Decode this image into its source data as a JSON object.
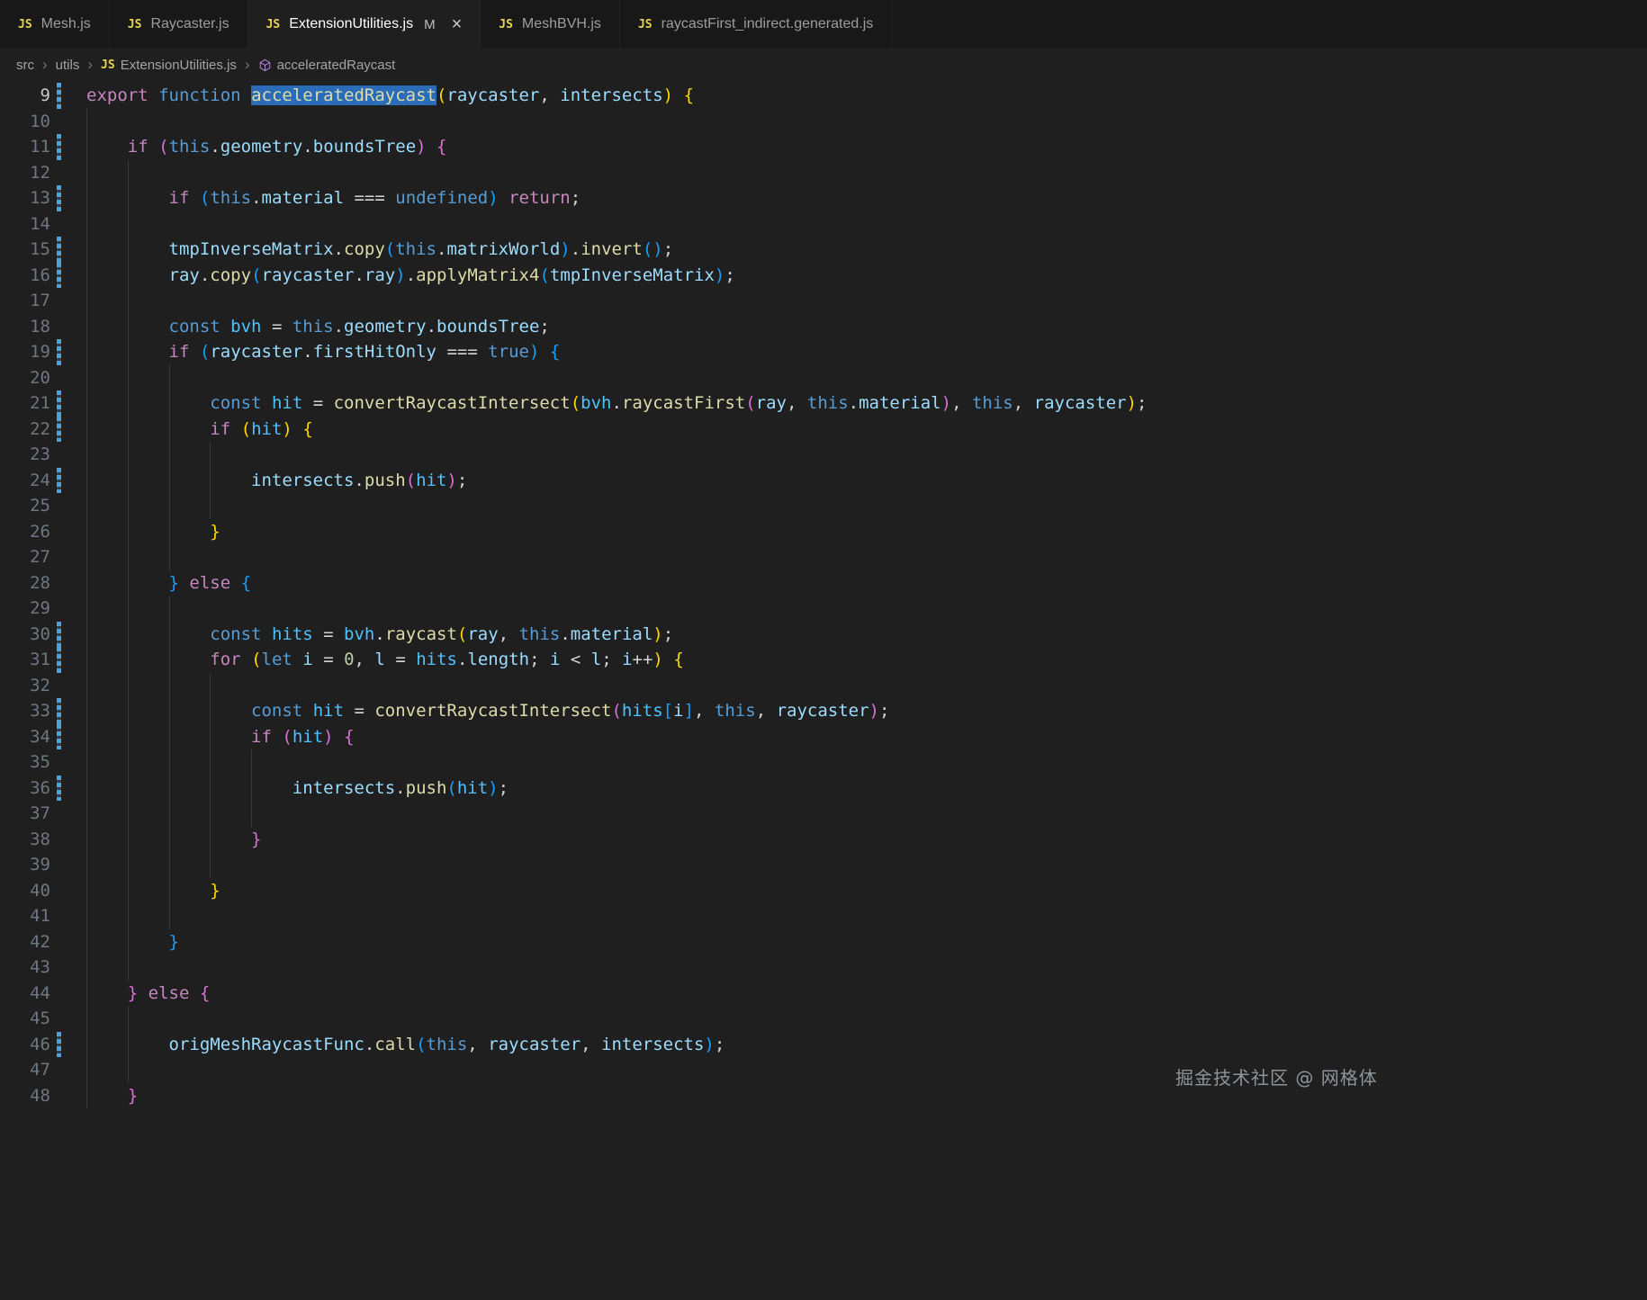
{
  "tabs": [
    {
      "label": "Mesh.js",
      "icon": "JS",
      "active": false
    },
    {
      "label": "Raycaster.js",
      "icon": "JS",
      "active": false
    },
    {
      "label": "ExtensionUtilities.js",
      "icon": "JS",
      "active": true,
      "badge": "M",
      "close": "×"
    },
    {
      "label": "MeshBVH.js",
      "icon": "JS",
      "active": false
    },
    {
      "label": "raycastFirst_indirect.generated.js",
      "icon": "JS",
      "active": false
    }
  ],
  "breadcrumb": {
    "separator": "›",
    "items": [
      {
        "label": "src"
      },
      {
        "label": "utils"
      },
      {
        "label": "ExtensionUtilities.js",
        "icon": "js"
      },
      {
        "label": "acceleratedRaycast",
        "icon": "cube"
      }
    ]
  },
  "editor": {
    "colors": {
      "editorBg": "#1F1F1F",
      "tabBarBg": "#181818",
      "jsIcon": "#E8D44D",
      "kw": "#C586C0",
      "storage": "#569CD6",
      "variable": "#9CDCFE",
      "constant": "#4FC1FF",
      "func": "#DCDCAA",
      "punct": "#D4D4D4",
      "num": "#B5CEA8",
      "br1": "#FFD700",
      "br2": "#DA70D6",
      "br3": "#179FFF",
      "selBg": "#2B6CB8",
      "modBar": "#4DA2DC",
      "lineNum": "#6E7681",
      "lineNumActive": "#C6C6C6",
      "guide": "#393939"
    },
    "lines": [
      {
        "n": 9,
        "cur": true,
        "mod": true,
        "g": 0,
        "t": [
          [
            "k",
            "export"
          ],
          [
            "p",
            " "
          ],
          [
            "b",
            "function"
          ],
          [
            "p",
            " "
          ],
          [
            "sel",
            "acceleratedRaycast"
          ],
          [
            "g",
            "("
          ],
          [
            "v",
            "raycaster"
          ],
          [
            "p",
            ", "
          ],
          [
            "v",
            "intersects"
          ],
          [
            "g",
            ")"
          ],
          [
            "p",
            " "
          ],
          [
            "g",
            "{"
          ]
        ]
      },
      {
        "n": 10,
        "g": 1,
        "t": []
      },
      {
        "n": 11,
        "mod": true,
        "g": 1,
        "t": [
          [
            "p",
            "    "
          ],
          [
            "k",
            "if"
          ],
          [
            "p",
            " "
          ],
          [
            "m",
            "("
          ],
          [
            "b",
            "this"
          ],
          [
            "p",
            "."
          ],
          [
            "v",
            "geometry"
          ],
          [
            "p",
            "."
          ],
          [
            "v",
            "boundsTree"
          ],
          [
            "m",
            ")"
          ],
          [
            "p",
            " "
          ],
          [
            "m",
            "{"
          ]
        ]
      },
      {
        "n": 12,
        "g": 2,
        "t": []
      },
      {
        "n": 13,
        "mod": true,
        "g": 2,
        "t": [
          [
            "p",
            "        "
          ],
          [
            "k",
            "if"
          ],
          [
            "p",
            " "
          ],
          [
            "u",
            "("
          ],
          [
            "b",
            "this"
          ],
          [
            "p",
            "."
          ],
          [
            "v",
            "material"
          ],
          [
            "p",
            " === "
          ],
          [
            "b",
            "undefined"
          ],
          [
            "u",
            ")"
          ],
          [
            "p",
            " "
          ],
          [
            "k",
            "return"
          ],
          [
            "p",
            ";"
          ]
        ]
      },
      {
        "n": 14,
        "g": 2,
        "t": []
      },
      {
        "n": 15,
        "mod": true,
        "g": 2,
        "t": [
          [
            "p",
            "        "
          ],
          [
            "v",
            "tmpInverseMatrix"
          ],
          [
            "p",
            "."
          ],
          [
            "f",
            "copy"
          ],
          [
            "u",
            "("
          ],
          [
            "b",
            "this"
          ],
          [
            "p",
            "."
          ],
          [
            "v",
            "matrixWorld"
          ],
          [
            "u",
            ")"
          ],
          [
            "p",
            "."
          ],
          [
            "f",
            "invert"
          ],
          [
            "u",
            "()"
          ],
          [
            "p",
            ";"
          ]
        ]
      },
      {
        "n": 16,
        "mod": true,
        "g": 2,
        "t": [
          [
            "p",
            "        "
          ],
          [
            "v",
            "ray"
          ],
          [
            "p",
            "."
          ],
          [
            "f",
            "copy"
          ],
          [
            "u",
            "("
          ],
          [
            "v",
            "raycaster"
          ],
          [
            "p",
            "."
          ],
          [
            "v",
            "ray"
          ],
          [
            "u",
            ")"
          ],
          [
            "p",
            "."
          ],
          [
            "f",
            "applyMatrix4"
          ],
          [
            "u",
            "("
          ],
          [
            "v",
            "tmpInverseMatrix"
          ],
          [
            "u",
            ")"
          ],
          [
            "p",
            ";"
          ]
        ]
      },
      {
        "n": 17,
        "g": 2,
        "t": []
      },
      {
        "n": 18,
        "g": 2,
        "t": [
          [
            "p",
            "        "
          ],
          [
            "b",
            "const"
          ],
          [
            "p",
            " "
          ],
          [
            "c",
            "bvh"
          ],
          [
            "p",
            " = "
          ],
          [
            "b",
            "this"
          ],
          [
            "p",
            "."
          ],
          [
            "v",
            "geometry"
          ],
          [
            "p",
            "."
          ],
          [
            "v",
            "boundsTree"
          ],
          [
            "p",
            ";"
          ]
        ]
      },
      {
        "n": 19,
        "mod": true,
        "g": 2,
        "t": [
          [
            "p",
            "        "
          ],
          [
            "k",
            "if"
          ],
          [
            "p",
            " "
          ],
          [
            "u",
            "("
          ],
          [
            "v",
            "raycaster"
          ],
          [
            "p",
            "."
          ],
          [
            "v",
            "firstHitOnly"
          ],
          [
            "p",
            " === "
          ],
          [
            "b",
            "true"
          ],
          [
            "u",
            ")"
          ],
          [
            "p",
            " "
          ],
          [
            "u",
            "{"
          ]
        ]
      },
      {
        "n": 20,
        "g": 3,
        "t": []
      },
      {
        "n": 21,
        "mod": true,
        "g": 3,
        "t": [
          [
            "p",
            "            "
          ],
          [
            "b",
            "const"
          ],
          [
            "p",
            " "
          ],
          [
            "c",
            "hit"
          ],
          [
            "p",
            " = "
          ],
          [
            "f",
            "convertRaycastIntersect"
          ],
          [
            "g",
            "("
          ],
          [
            "c",
            "bvh"
          ],
          [
            "p",
            "."
          ],
          [
            "f",
            "raycastFirst"
          ],
          [
            "m",
            "("
          ],
          [
            "v",
            "ray"
          ],
          [
            "p",
            ", "
          ],
          [
            "b",
            "this"
          ],
          [
            "p",
            "."
          ],
          [
            "v",
            "material"
          ],
          [
            "m",
            ")"
          ],
          [
            "p",
            ", "
          ],
          [
            "b",
            "this"
          ],
          [
            "p",
            ", "
          ],
          [
            "v",
            "raycaster"
          ],
          [
            "g",
            ")"
          ],
          [
            "p",
            ";"
          ]
        ]
      },
      {
        "n": 22,
        "mod": true,
        "g": 3,
        "t": [
          [
            "p",
            "            "
          ],
          [
            "k",
            "if"
          ],
          [
            "p",
            " "
          ],
          [
            "g",
            "("
          ],
          [
            "c",
            "hit"
          ],
          [
            "g",
            ")"
          ],
          [
            "p",
            " "
          ],
          [
            "g",
            "{"
          ]
        ]
      },
      {
        "n": 23,
        "g": 4,
        "t": []
      },
      {
        "n": 24,
        "mod": true,
        "g": 4,
        "t": [
          [
            "p",
            "                "
          ],
          [
            "v",
            "intersects"
          ],
          [
            "p",
            "."
          ],
          [
            "f",
            "push"
          ],
          [
            "m",
            "("
          ],
          [
            "c",
            "hit"
          ],
          [
            "m",
            ")"
          ],
          [
            "p",
            ";"
          ]
        ]
      },
      {
        "n": 25,
        "g": 4,
        "t": []
      },
      {
        "n": 26,
        "g": 3,
        "t": [
          [
            "p",
            "            "
          ],
          [
            "g",
            "}"
          ]
        ]
      },
      {
        "n": 27,
        "g": 3,
        "t": []
      },
      {
        "n": 28,
        "g": 2,
        "t": [
          [
            "p",
            "        "
          ],
          [
            "u",
            "}"
          ],
          [
            "p",
            " "
          ],
          [
            "k",
            "else"
          ],
          [
            "p",
            " "
          ],
          [
            "u",
            "{"
          ]
        ]
      },
      {
        "n": 29,
        "g": 3,
        "t": []
      },
      {
        "n": 30,
        "mod": true,
        "g": 3,
        "t": [
          [
            "p",
            "            "
          ],
          [
            "b",
            "const"
          ],
          [
            "p",
            " "
          ],
          [
            "c",
            "hits"
          ],
          [
            "p",
            " = "
          ],
          [
            "c",
            "bvh"
          ],
          [
            "p",
            "."
          ],
          [
            "f",
            "raycast"
          ],
          [
            "g",
            "("
          ],
          [
            "v",
            "ray"
          ],
          [
            "p",
            ", "
          ],
          [
            "b",
            "this"
          ],
          [
            "p",
            "."
          ],
          [
            "v",
            "material"
          ],
          [
            "g",
            ")"
          ],
          [
            "p",
            ";"
          ]
        ]
      },
      {
        "n": 31,
        "mod": true,
        "g": 3,
        "t": [
          [
            "p",
            "            "
          ],
          [
            "k",
            "for"
          ],
          [
            "p",
            " "
          ],
          [
            "g",
            "("
          ],
          [
            "b",
            "let"
          ],
          [
            "p",
            " "
          ],
          [
            "v",
            "i"
          ],
          [
            "p",
            " = "
          ],
          [
            "n",
            "0"
          ],
          [
            "p",
            ", "
          ],
          [
            "v",
            "l"
          ],
          [
            "p",
            " = "
          ],
          [
            "c",
            "hits"
          ],
          [
            "p",
            "."
          ],
          [
            "v",
            "length"
          ],
          [
            "p",
            "; "
          ],
          [
            "v",
            "i"
          ],
          [
            "p",
            " < "
          ],
          [
            "v",
            "l"
          ],
          [
            "p",
            "; "
          ],
          [
            "v",
            "i"
          ],
          [
            "p",
            "++"
          ],
          [
            "g",
            ")"
          ],
          [
            "p",
            " "
          ],
          [
            "g",
            "{"
          ]
        ]
      },
      {
        "n": 32,
        "g": 4,
        "t": []
      },
      {
        "n": 33,
        "mod": true,
        "g": 4,
        "t": [
          [
            "p",
            "                "
          ],
          [
            "b",
            "const"
          ],
          [
            "p",
            " "
          ],
          [
            "c",
            "hit"
          ],
          [
            "p",
            " = "
          ],
          [
            "f",
            "convertRaycastIntersect"
          ],
          [
            "m",
            "("
          ],
          [
            "c",
            "hits"
          ],
          [
            "u",
            "["
          ],
          [
            "v",
            "i"
          ],
          [
            "u",
            "]"
          ],
          [
            "p",
            ", "
          ],
          [
            "b",
            "this"
          ],
          [
            "p",
            ", "
          ],
          [
            "v",
            "raycaster"
          ],
          [
            "m",
            ")"
          ],
          [
            "p",
            ";"
          ]
        ]
      },
      {
        "n": 34,
        "mod": true,
        "g": 4,
        "t": [
          [
            "p",
            "                "
          ],
          [
            "k",
            "if"
          ],
          [
            "p",
            " "
          ],
          [
            "m",
            "("
          ],
          [
            "c",
            "hit"
          ],
          [
            "m",
            ")"
          ],
          [
            "p",
            " "
          ],
          [
            "m",
            "{"
          ]
        ]
      },
      {
        "n": 35,
        "g": 5,
        "t": []
      },
      {
        "n": 36,
        "mod": true,
        "g": 5,
        "t": [
          [
            "p",
            "                    "
          ],
          [
            "v",
            "intersects"
          ],
          [
            "p",
            "."
          ],
          [
            "f",
            "push"
          ],
          [
            "u",
            "("
          ],
          [
            "c",
            "hit"
          ],
          [
            "u",
            ")"
          ],
          [
            "p",
            ";"
          ]
        ]
      },
      {
        "n": 37,
        "g": 5,
        "t": []
      },
      {
        "n": 38,
        "g": 4,
        "t": [
          [
            "p",
            "                "
          ],
          [
            "m",
            "}"
          ]
        ]
      },
      {
        "n": 39,
        "g": 4,
        "t": []
      },
      {
        "n": 40,
        "g": 3,
        "t": [
          [
            "p",
            "            "
          ],
          [
            "g",
            "}"
          ]
        ]
      },
      {
        "n": 41,
        "g": 3,
        "t": []
      },
      {
        "n": 42,
        "g": 2,
        "t": [
          [
            "p",
            "        "
          ],
          [
            "u",
            "}"
          ]
        ]
      },
      {
        "n": 43,
        "g": 2,
        "t": []
      },
      {
        "n": 44,
        "g": 1,
        "t": [
          [
            "p",
            "    "
          ],
          [
            "m",
            "}"
          ],
          [
            "p",
            " "
          ],
          [
            "k",
            "else"
          ],
          [
            "p",
            " "
          ],
          [
            "m",
            "{"
          ]
        ]
      },
      {
        "n": 45,
        "g": 2,
        "t": []
      },
      {
        "n": 46,
        "mod": true,
        "g": 2,
        "t": [
          [
            "p",
            "        "
          ],
          [
            "v",
            "origMeshRaycastFunc"
          ],
          [
            "p",
            "."
          ],
          [
            "f",
            "call"
          ],
          [
            "u",
            "("
          ],
          [
            "b",
            "this"
          ],
          [
            "p",
            ", "
          ],
          [
            "v",
            "raycaster"
          ],
          [
            "p",
            ", "
          ],
          [
            "v",
            "intersects"
          ],
          [
            "u",
            ")"
          ],
          [
            "p",
            ";"
          ]
        ]
      },
      {
        "n": 47,
        "g": 2,
        "t": []
      },
      {
        "n": 48,
        "g": 1,
        "t": [
          [
            "p",
            "    "
          ],
          [
            "m",
            "}"
          ]
        ]
      }
    ]
  },
  "watermark": {
    "text": "掘金技术社区 @ 网格体"
  }
}
